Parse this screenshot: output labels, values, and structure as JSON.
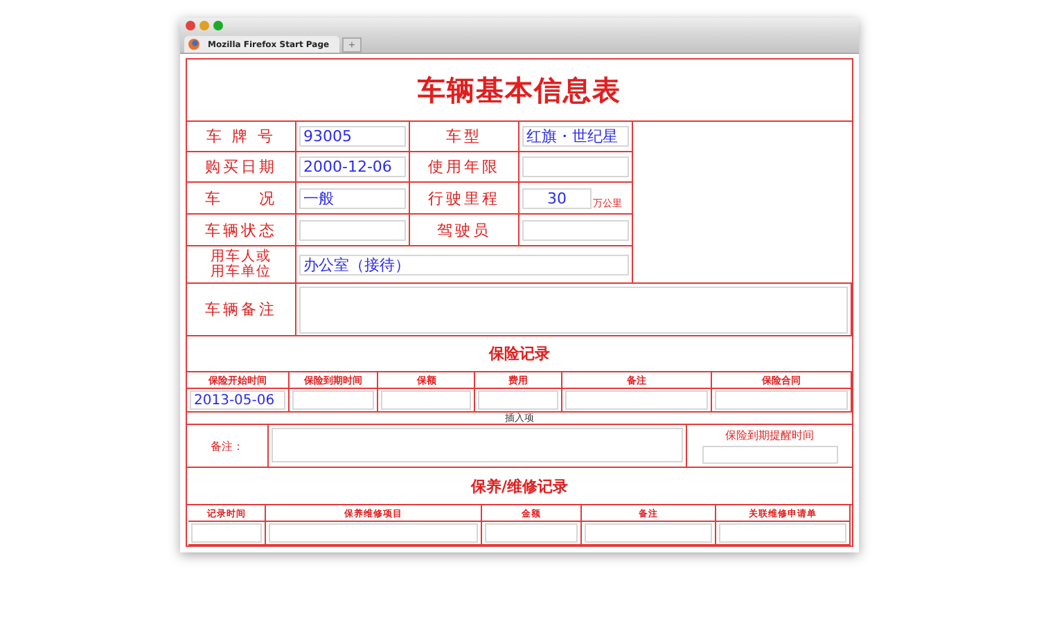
{
  "browser": {
    "tab_title": "Mozilla Firefox Start Page",
    "new_tab": "+"
  },
  "form": {
    "title": "车辆基本信息表",
    "rows": [
      {
        "label": "车 牌 号",
        "value": "93005",
        "label2": "车型",
        "value2": "红旗・世纪星"
      },
      {
        "label": "购买日期",
        "value": "2000-12-06",
        "label2": "使用年限"
      },
      {
        "label": "车　　况",
        "value": "一般",
        "label2": "行驶里程",
        "value2": "30",
        "unit": "万公里"
      },
      {
        "label": "车辆状态",
        "label2": "驾驶员"
      }
    ],
    "user": {
      "label": "用车人或用车单位",
      "value": "办公室（接待）"
    },
    "remark": {
      "label": "车辆备注"
    }
  },
  "insurance": {
    "title": "保险记录",
    "columns": [
      "保险开始时间",
      "保险到期时间",
      "保额",
      "费用",
      "备注",
      "保险合同"
    ],
    "start_date": "2013-05-06",
    "insert": "插入项",
    "remark_label": "备注：",
    "reminder_label": "保险到期提醒时间"
  },
  "maintenance": {
    "title": "保养/维修记录",
    "columns": [
      "记录时间",
      "保养维修项目",
      "金额",
      "备注",
      "关联维修申请单"
    ]
  }
}
